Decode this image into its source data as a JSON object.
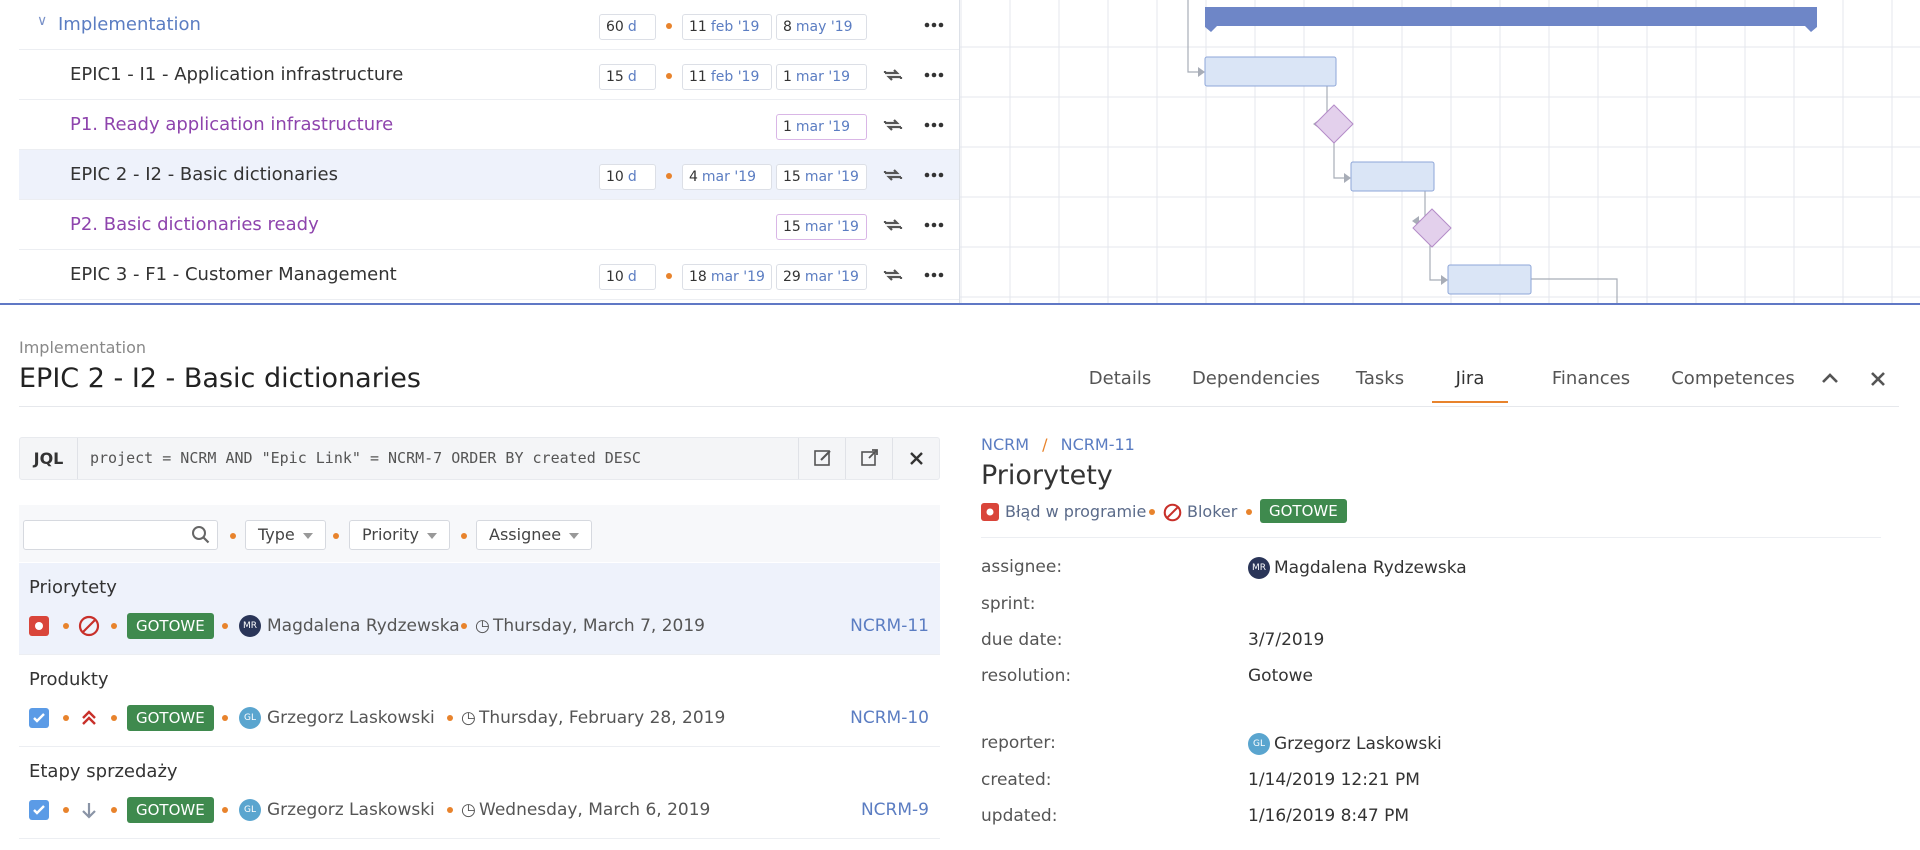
{
  "gantt_tasks": [
    {
      "name": "Implementation",
      "kind": "group",
      "duration": "60",
      "duration_unit": "d",
      "start_day": "11",
      "start_month": "feb '19",
      "end_day": "8",
      "end_month": "may '19"
    },
    {
      "name": "EPIC1 - I1 - Application infrastructure",
      "kind": "task",
      "duration": "15",
      "duration_unit": "d",
      "start_day": "11",
      "start_month": "feb '19",
      "end_day": "1",
      "end_month": "mar '19"
    },
    {
      "name": "P1. Ready application infrastructure",
      "kind": "milestone",
      "end_day": "1",
      "end_month": "mar '19"
    },
    {
      "name": "EPIC 2 - I2 - Basic dictionaries",
      "kind": "task",
      "duration": "10",
      "duration_unit": "d",
      "start_day": "4",
      "start_month": "mar '19",
      "end_day": "15",
      "end_month": "mar '19"
    },
    {
      "name": "P2. Basic dictionaries ready",
      "kind": "milestone",
      "end_day": "15",
      "end_month": "mar '19"
    },
    {
      "name": "EPIC 3 - F1 - Customer Management",
      "kind": "task",
      "duration": "10",
      "duration_unit": "d",
      "start_day": "18",
      "start_month": "mar '19",
      "end_day": "29",
      "end_month": "mar '19"
    }
  ],
  "selected_task_index": 3,
  "panel": {
    "breadcrumb": "Implementation",
    "title": "EPIC 2 - I2 - Basic dictionaries",
    "tabs": [
      "Details",
      "Dependencies",
      "Tasks",
      "Jira",
      "Finances",
      "Competences"
    ],
    "active_tab": "Jira"
  },
  "jql": {
    "label": "JQL",
    "query": "project = NCRM AND \"Epic Link\" = NCRM-7 ORDER BY created DESC"
  },
  "filters": {
    "search_placeholder": "",
    "type_label": "Type",
    "priority_label": "Priority",
    "assignee_label": "Assignee"
  },
  "issues": [
    {
      "title": "Priorytety",
      "status": "GOTOWE",
      "assignee": "Magdalena Rydzewska",
      "assignee_initials": "MR",
      "date": "Thursday, March 7, 2019",
      "key": "NCRM-11",
      "type_icon": "bug-icon",
      "priority_icon": "blocker-icon"
    },
    {
      "title": "Produkty",
      "status": "GOTOWE",
      "assignee": "Grzegorz Laskowski",
      "assignee_initials": "GL",
      "date": "Thursday, February 28, 2019",
      "key": "NCRM-10",
      "type_icon": "task-icon",
      "priority_icon": "highest-priority-icon"
    },
    {
      "title": "Etapy sprzedaży",
      "status": "GOTOWE",
      "assignee": "Grzegorz Laskowski",
      "assignee_initials": "GL",
      "date": "Wednesday, March 6, 2019",
      "key": "NCRM-9",
      "type_icon": "task-icon",
      "priority_icon": "low-priority-icon"
    }
  ],
  "detail": {
    "project": "NCRM",
    "separator": "/",
    "key": "NCRM-11",
    "title": "Priorytety",
    "type": "Błąd w programie",
    "priority": "Bloker",
    "status": "GOTOWE",
    "fields": {
      "assignee_label": "assignee:",
      "assignee": "Magdalena Rydzewska",
      "assignee_initials": "MR",
      "sprint_label": "sprint:",
      "sprint": "",
      "due_label": "due date:",
      "due": "3/7/2019",
      "resolution_label": "resolution:",
      "resolution": "Gotowe",
      "reporter_label": "reporter:",
      "reporter": "Grzegorz Laskowski",
      "reporter_initials": "GL",
      "created_label": "created:",
      "created": "1/14/2019 12:21 PM",
      "updated_label": "updated:",
      "updated": "1/16/2019 8:47 PM"
    }
  },
  "colors": {
    "accent": "#5b7dc2",
    "milestone": "#8e44ad",
    "status_done": "#3f8a4e",
    "bullet": "#e8832c",
    "bug": "#d9453a",
    "task": "#5b9be6"
  }
}
